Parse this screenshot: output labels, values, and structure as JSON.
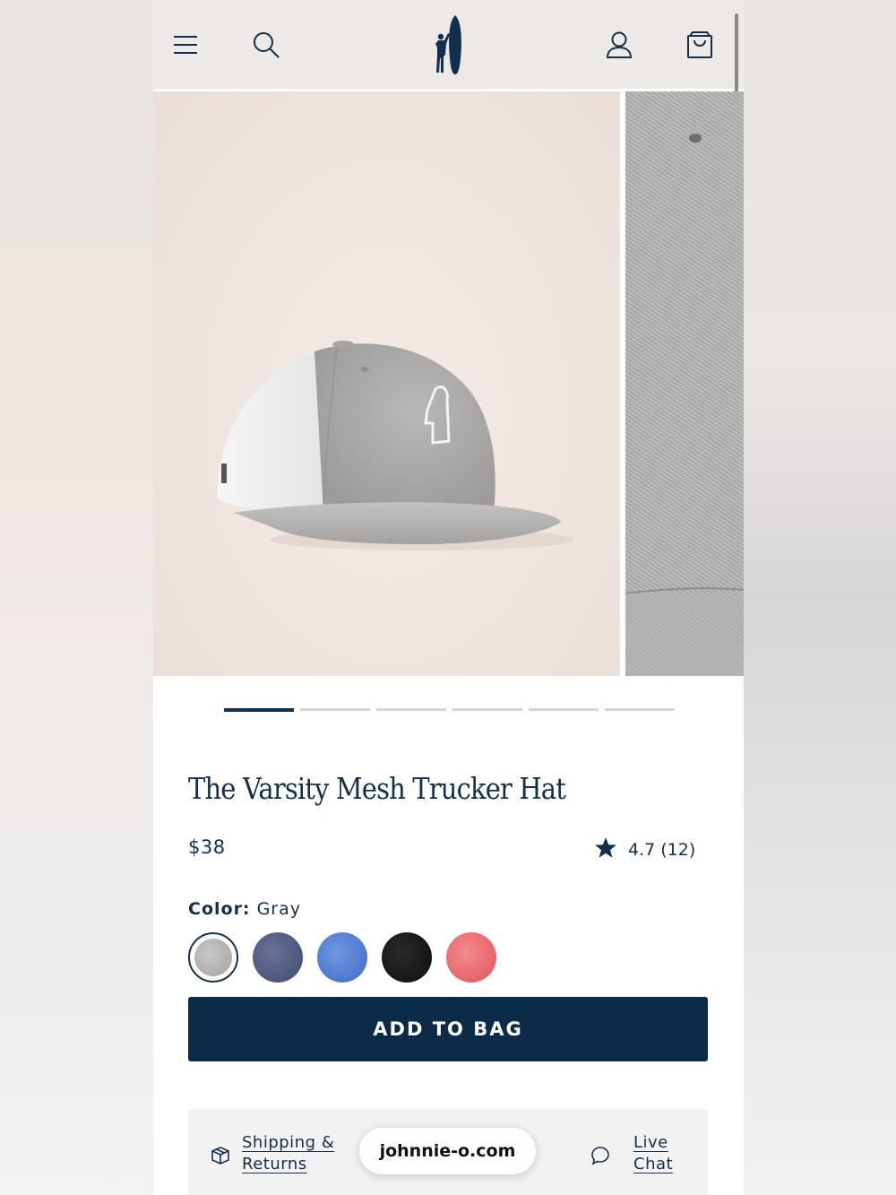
{
  "header": {
    "menu_icon": "hamburger-icon",
    "search_icon": "search-icon",
    "logo_icon": "surfer-logo-icon",
    "account_icon": "account-icon",
    "bag_icon": "shopping-bag-icon"
  },
  "gallery": {
    "slide_count": 6,
    "active_index": 0
  },
  "product": {
    "title": "The Varsity Mesh Trucker Hat",
    "price": "$38",
    "rating": "4.7 (12)",
    "color_key": "Color:",
    "color_value": "Gray",
    "swatches": [
      {
        "name": "gray",
        "color": "#b5b3b1",
        "selected": true
      },
      {
        "name": "navy-heather",
        "color": "#4c5880",
        "selected": false
      },
      {
        "name": "blue-heather",
        "color": "#4f7ed6",
        "selected": false
      },
      {
        "name": "black",
        "color": "#161616",
        "selected": false
      },
      {
        "name": "red-heather",
        "color": "#e8666b",
        "selected": false
      }
    ],
    "add_to_bag": "ADD TO BAG"
  },
  "info": {
    "shipping_line1": "Shipping &",
    "shipping_line2": "Returns",
    "chat_line1": "Live",
    "chat_line2": "Chat"
  },
  "browser": {
    "url": "johnnie-o.com"
  },
  "colors": {
    "navy": "#0c2b48",
    "header_bg": "#ece9e6"
  }
}
